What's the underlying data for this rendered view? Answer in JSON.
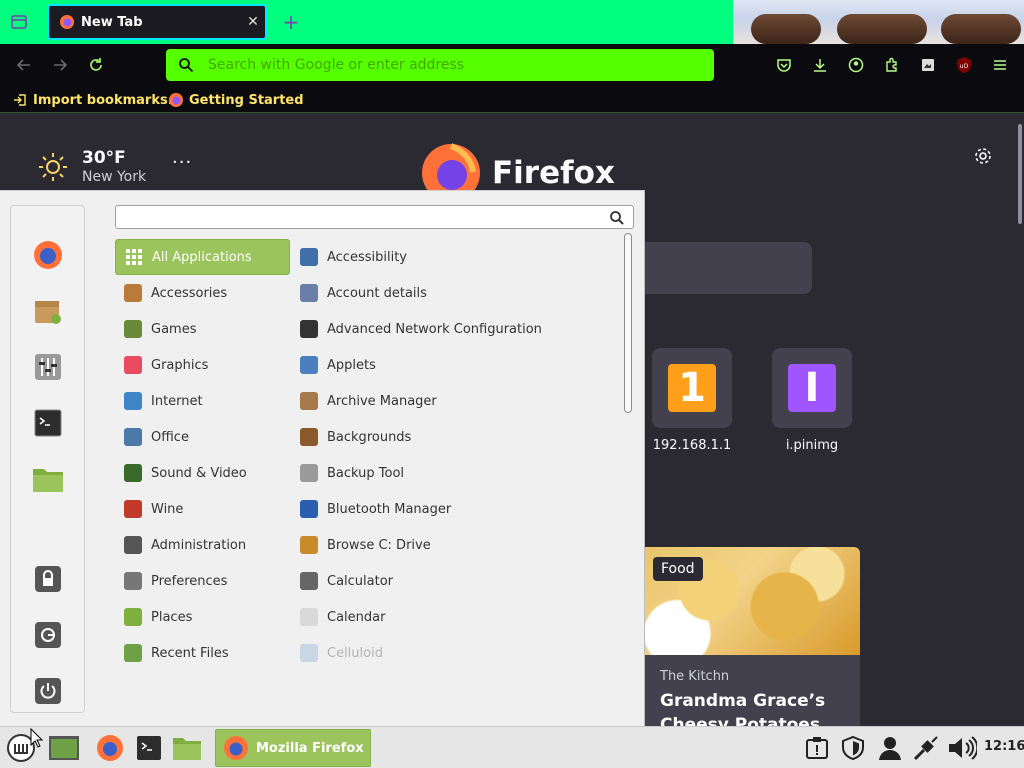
{
  "browser": {
    "tab": {
      "title": "New Tab",
      "close_glyph": "✕"
    },
    "new_tab_glyph": "+",
    "urlbar": {
      "placeholder": "Search with Google or enter address",
      "value": ""
    },
    "bookmarks": [
      {
        "label": "Import bookmarks...",
        "icon": "import-icon"
      },
      {
        "label": "Getting Started",
        "icon": "firefox-icon"
      }
    ],
    "toolbar_icons": [
      "pocket-icon",
      "download-icon",
      "account-icon",
      "extensions-icon",
      "screenshot-icon",
      "ublock-icon",
      "menu-icon"
    ],
    "colors": {
      "tabbar": "#00ff7f",
      "urlbar": "#55ff00",
      "bookmark_text": "#ffe46b"
    }
  },
  "newtab": {
    "weather": {
      "temp": "30°F",
      "city": "New York",
      "more": "···"
    },
    "brand": "Firefox",
    "top_sites": [
      {
        "label": "192.168.1.1",
        "letter": "1",
        "color": "#ff9f1a"
      },
      {
        "label": "i.pinimg",
        "letter": "I",
        "color": "#9f55ff"
      }
    ],
    "story": {
      "tag": "Food",
      "source": "The Kitchn",
      "title": "Grandma Grace’s Cheesy Potatoes Are"
    }
  },
  "menu": {
    "search": {
      "value": "",
      "placeholder": ""
    },
    "favorites": [
      "firefox-icon",
      "software-manager-icon",
      "system-settings-icon",
      "terminal-icon",
      "folder-icon",
      "lock-icon",
      "logout-icon",
      "power-icon"
    ],
    "categories": [
      {
        "label": "All Applications",
        "active": true,
        "color": "#7fb03f"
      },
      {
        "label": "Accessories",
        "color": "#b97a3a"
      },
      {
        "label": "Games",
        "color": "#6a8a3a"
      },
      {
        "label": "Graphics",
        "color": "#e84a5f"
      },
      {
        "label": "Internet",
        "color": "#3f86c9"
      },
      {
        "label": "Office",
        "color": "#4c7aa8"
      },
      {
        "label": "Sound & Video",
        "color": "#3a6a2a"
      },
      {
        "label": "Wine",
        "color": "#c0392b"
      },
      {
        "label": "Administration",
        "color": "#555555"
      },
      {
        "label": "Preferences",
        "color": "#777777"
      },
      {
        "label": "Places",
        "color": "#7fb03f"
      },
      {
        "label": "Recent Files",
        "color": "#6ea045"
      }
    ],
    "apps": [
      {
        "label": "Accessibility",
        "color": "#3f6ea8"
      },
      {
        "label": "Account details",
        "color": "#6a7fa8"
      },
      {
        "label": "Advanced Network Configuration",
        "color": "#333333"
      },
      {
        "label": "Applets",
        "color": "#4a7fc0"
      },
      {
        "label": "Archive Manager",
        "color": "#a67a4a"
      },
      {
        "label": "Backgrounds",
        "color": "#8a5a2a"
      },
      {
        "label": "Backup Tool",
        "color": "#9a9a9a"
      },
      {
        "label": "Bluetooth Manager",
        "color": "#2a5fb0"
      },
      {
        "label": "Browse C: Drive",
        "color": "#c98a2a"
      },
      {
        "label": "Calculator",
        "color": "#666666"
      },
      {
        "label": "Calendar",
        "color": "#d9d9d9"
      },
      {
        "label": "Celluloid",
        "color": "#c8d6e6",
        "dim": true
      }
    ]
  },
  "taskbar": {
    "window_label": "Mozilla Firefox",
    "clock": "12:16",
    "launchers": [
      "mint-menu-icon",
      "show-desktop-icon",
      "firefox-icon",
      "terminal-icon",
      "folder-icon"
    ],
    "tray": [
      "update-manager-icon",
      "shield-icon",
      "user-icon",
      "network-icon",
      "volume-icon"
    ]
  }
}
